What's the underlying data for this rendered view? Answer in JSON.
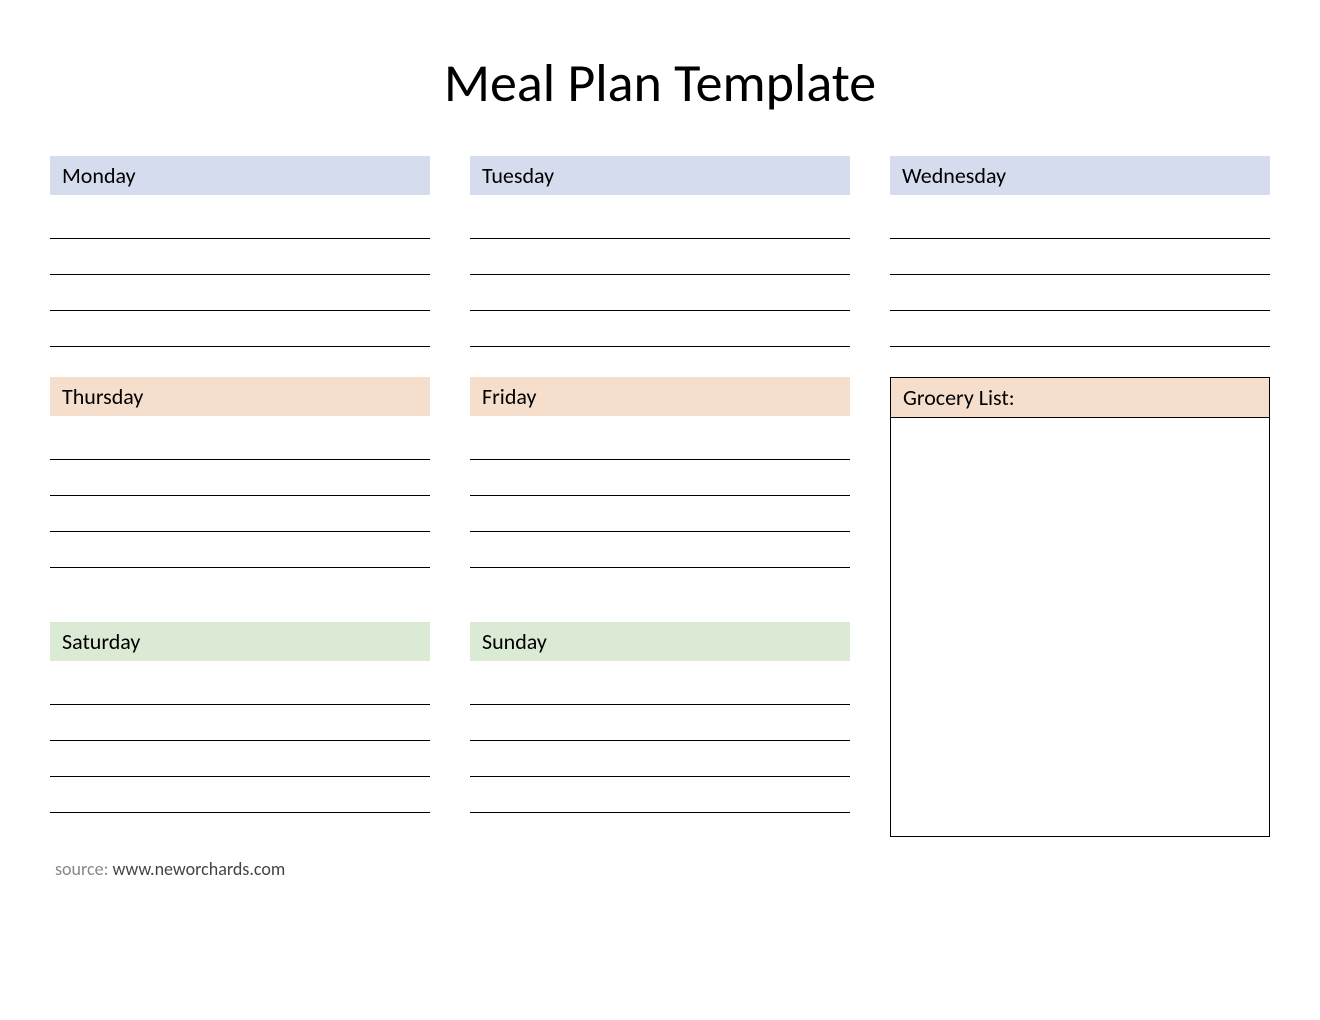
{
  "title": "Meal Plan Template",
  "days": {
    "monday": "Monday",
    "tuesday": "Tuesday",
    "wednesday": "Wednesday",
    "thursday": "Thursday",
    "friday": "Friday",
    "saturday": "Saturday",
    "sunday": "Sunday"
  },
  "grocery": {
    "label": "Grocery List:"
  },
  "source": {
    "prefix": "source: ",
    "url": "www.neworchards.com"
  },
  "colors": {
    "blue": "#d5dced",
    "peach": "#f6decd",
    "green": "#dbead5"
  }
}
